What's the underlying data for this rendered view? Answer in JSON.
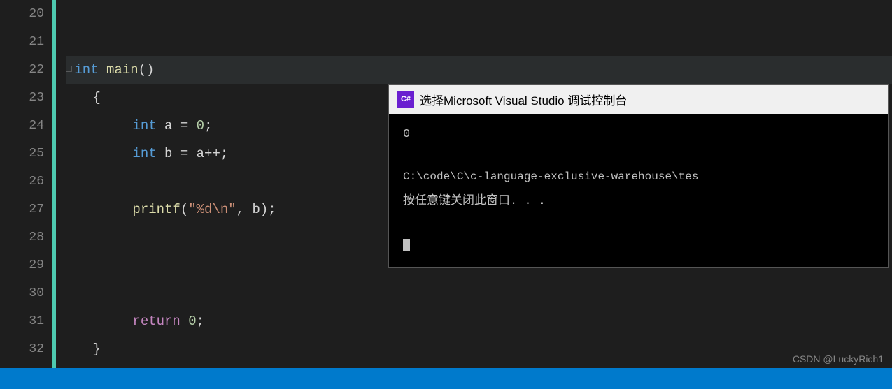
{
  "editor": {
    "background": "#1e1e1e",
    "lines": [
      {
        "num": "20",
        "content": "",
        "tokens": []
      },
      {
        "num": "21",
        "content": "",
        "tokens": []
      },
      {
        "num": "22",
        "content": "int main()",
        "highlighted": true,
        "hasCollapse": true,
        "tokens": [
          {
            "text": "int",
            "class": "kw-blue"
          },
          {
            "text": " ",
            "class": "kw-white"
          },
          {
            "text": "main",
            "class": "kw-yellow"
          },
          {
            "text": "()",
            "class": "kw-white"
          }
        ]
      },
      {
        "num": "23",
        "content": "{",
        "tokens": [
          {
            "text": "{",
            "class": "kw-white"
          }
        ]
      },
      {
        "num": "24",
        "content": "    int a = 0;",
        "indent": 2,
        "tokens": [
          {
            "text": "int",
            "class": "kw-blue"
          },
          {
            "text": " a ",
            "class": "kw-white"
          },
          {
            "text": "=",
            "class": "kw-white"
          },
          {
            "text": " ",
            "class": "kw-white"
          },
          {
            "text": "0",
            "class": "kw-number"
          },
          {
            "text": ";",
            "class": "kw-white"
          }
        ]
      },
      {
        "num": "25",
        "content": "    int b = a++;",
        "indent": 2,
        "tokens": [
          {
            "text": "int",
            "class": "kw-blue"
          },
          {
            "text": " b ",
            "class": "kw-white"
          },
          {
            "text": "=",
            "class": "kw-white"
          },
          {
            "text": " a++",
            "class": "kw-white"
          },
          {
            "text": ";",
            "class": "kw-white"
          }
        ]
      },
      {
        "num": "26",
        "content": "",
        "tokens": []
      },
      {
        "num": "27",
        "content": "    printf(\"%d\\n\", b);",
        "indent": 2,
        "tokens": [
          {
            "text": "printf",
            "class": "kw-yellow"
          },
          {
            "text": "(",
            "class": "kw-white"
          },
          {
            "text": "\"%d\\n\"",
            "class": "kw-orange"
          },
          {
            "text": ", b)",
            "class": "kw-white"
          },
          {
            "text": ";",
            "class": "kw-white"
          }
        ]
      },
      {
        "num": "28",
        "content": "",
        "tokens": []
      },
      {
        "num": "29",
        "content": "",
        "tokens": []
      },
      {
        "num": "30",
        "content": "",
        "tokens": []
      },
      {
        "num": "31",
        "content": "    return 0;",
        "indent": 2,
        "tokens": [
          {
            "text": "return",
            "class": "kw-pink"
          },
          {
            "text": " ",
            "class": "kw-white"
          },
          {
            "text": "0",
            "class": "kw-number"
          },
          {
            "text": ";",
            "class": "kw-white"
          }
        ]
      },
      {
        "num": "32",
        "content": "}",
        "tokens": [
          {
            "text": "}",
            "class": "kw-white"
          }
        ]
      }
    ]
  },
  "popup": {
    "title": "选择Microsoft Visual Studio 调试控制台",
    "icon_text": "c#",
    "output_value": "0",
    "path_text": "C:\\code\\C\\c-language-exclusive-warehouse\\tes",
    "close_hint": "按任意键关闭此窗口. . ."
  },
  "watermark": {
    "text": "CSDN @LuckyRich1"
  }
}
